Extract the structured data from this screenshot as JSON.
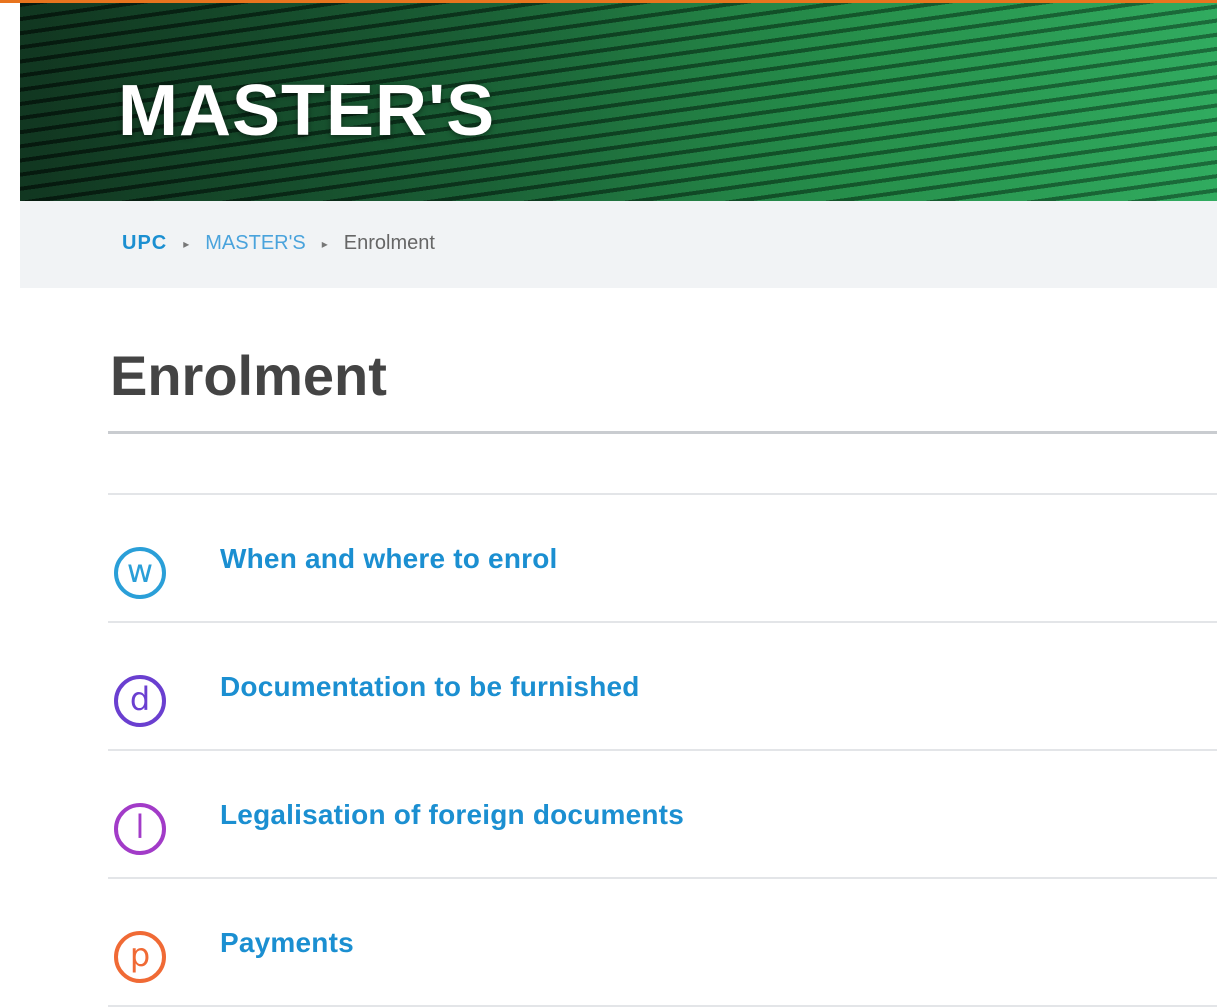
{
  "hero": {
    "title": "MASTER'S"
  },
  "breadcrumb": {
    "home": "UPC",
    "section": "MASTER'S",
    "current": "Enrolment",
    "separator": "▸"
  },
  "page": {
    "title": "Enrolment"
  },
  "items": [
    {
      "letter": "w",
      "label": "When and where to enrol",
      "color": "#2a9fd8",
      "icon": "letter-w-circle-icon"
    },
    {
      "letter": "d",
      "label": "Documentation to be furnished",
      "color": "#6a3fd0",
      "icon": "letter-d-circle-icon"
    },
    {
      "letter": "l",
      "label": "Legalisation of foreign documents",
      "color": "#a23bc8",
      "icon": "letter-l-circle-icon"
    },
    {
      "letter": "p",
      "label": "Payments",
      "color": "#f06a35",
      "icon": "letter-p-circle-icon"
    }
  ],
  "colors": {
    "accent": "#e8741e",
    "link": "#1b8fd1",
    "breadcrumb_bg": "#f1f3f5",
    "title": "#444444"
  }
}
